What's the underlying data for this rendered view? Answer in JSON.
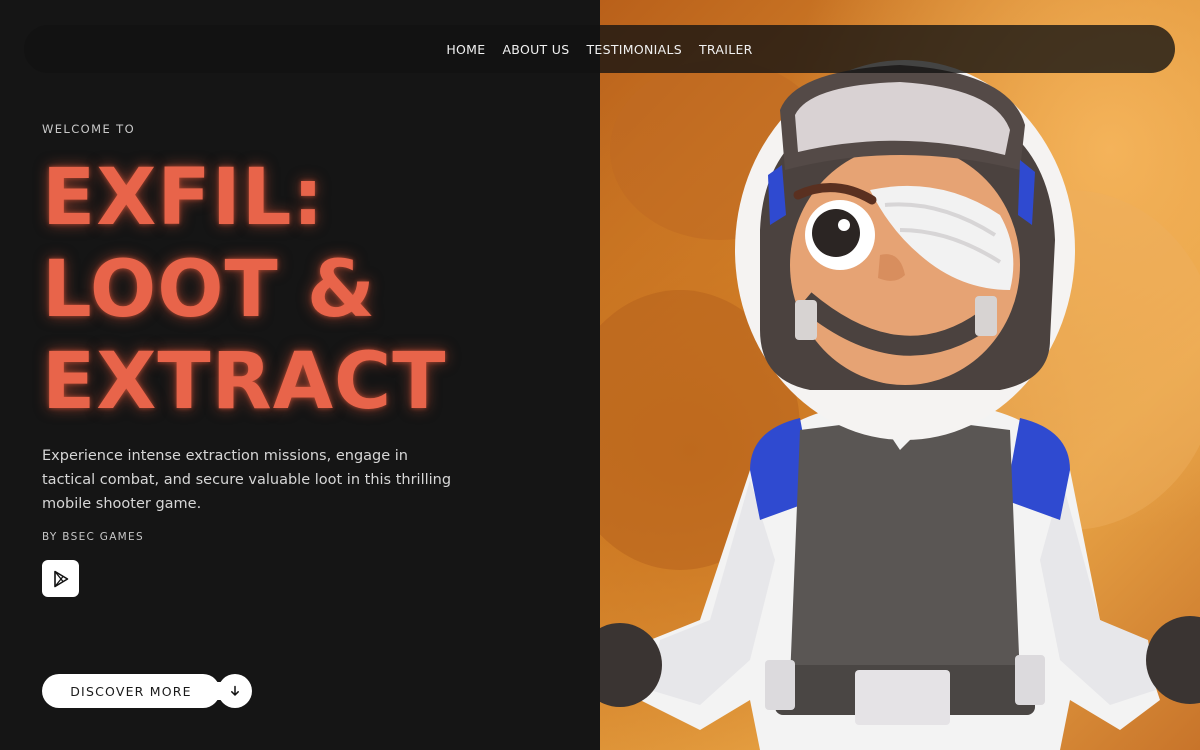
{
  "nav": {
    "items": [
      {
        "label": "HOME"
      },
      {
        "label": "ABOUT US"
      },
      {
        "label": "TESTIMONIALS"
      },
      {
        "label": "TRAILER"
      }
    ]
  },
  "hero": {
    "eyebrow": "WELCOME TO",
    "title_lines": [
      "EXFIL:",
      "LOOT &",
      "EXTRACT"
    ],
    "description": "Experience intense extraction missions, engage in tactical combat, and secure valuable loot in this thrilling mobile shooter game.",
    "byline": "BY BSEC GAMES",
    "store_icon": "google-play-icon",
    "cta_label": "DISCOVER MORE",
    "cta_icon": "arrow-down-icon"
  },
  "colors": {
    "background": "#151515",
    "accent": "#e8644a",
    "art_orange": "#d98a2f"
  }
}
